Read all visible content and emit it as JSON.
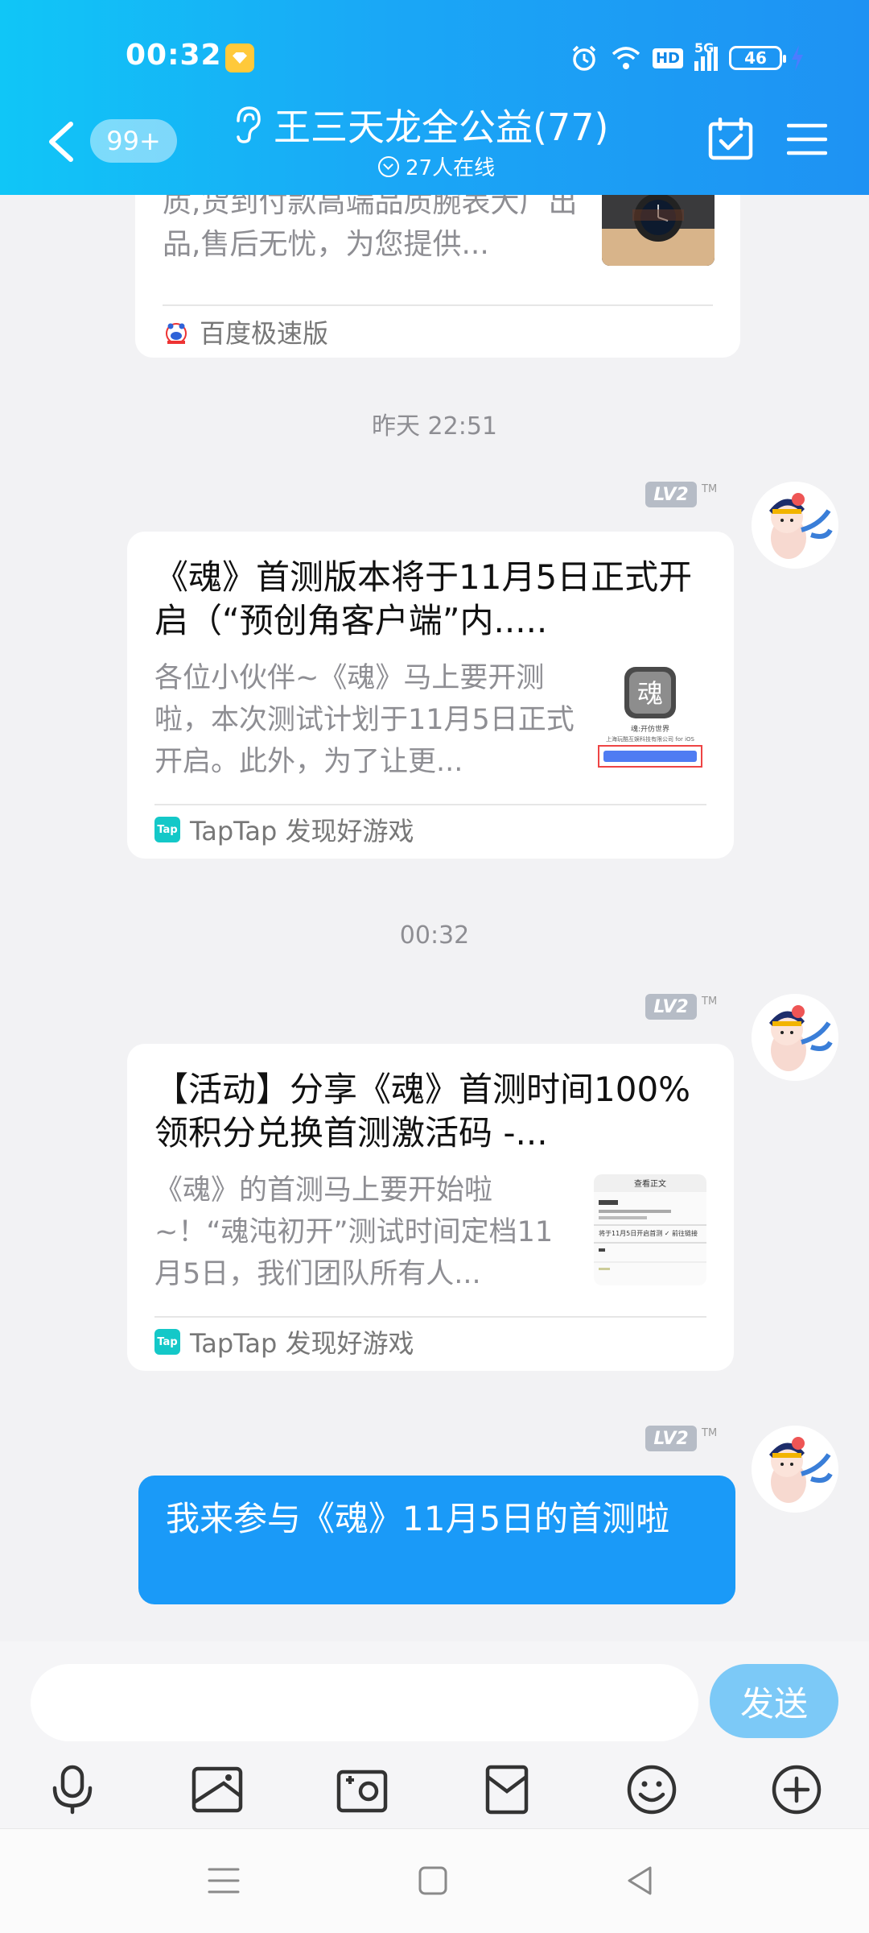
{
  "status_bar": {
    "time": "00:32",
    "hd": "HD",
    "network": "5G",
    "battery": "46"
  },
  "header": {
    "unread_count": "99+",
    "group_title": "王三天龙全公益(77)",
    "online_text": "27人在线"
  },
  "messages": [
    {
      "type": "link_card",
      "desc": "质,货到付款高端品质腕表大厂出品,售后无忧，为您提供...",
      "source": "百度极速版"
    },
    {
      "type": "timestamp",
      "text": "昨天 22:51"
    },
    {
      "type": "link_card",
      "level": "LV2",
      "title": "《魂》首测版本将于11月5日正式开启（“预创角客户端”内.....",
      "desc": "各位小伙伴~《魂》马上要开测啦，本次测试计划于11月5日正式开启。此外，为了让更...",
      "source": "TapTap 发现好游戏"
    },
    {
      "type": "timestamp",
      "text": "00:32"
    },
    {
      "type": "link_card",
      "level": "LV2",
      "title": "【活动】分享《魂》首测时间100%领积分兑换首测激活码 -...",
      "desc": "《魂》的首测马上要开始啦~！“魂沌初开”测试时间定档11月5日，我们团队所有人...",
      "source": "TapTap 发现好游戏"
    },
    {
      "type": "text",
      "level": "LV2",
      "text": "我来参与《魂》11月5日的首测啦"
    }
  ],
  "tm_mark": "TM",
  "tap_logo_text": "Tap",
  "thumb_text": {
    "game_title": "魂:开仿世界",
    "company": "上海玩酷互娱科技有限公司 for iOS",
    "article_header": "查看正文",
    "article_line": "将于11月5日开启首测 ✓ 前往链接"
  },
  "input": {
    "placeholder": "",
    "send_label": "发送"
  },
  "colors": {
    "header_start": "#10c6f7",
    "header_end": "#1e92f3",
    "bubble": "#1a9af8",
    "send": "#7cc9f7"
  }
}
